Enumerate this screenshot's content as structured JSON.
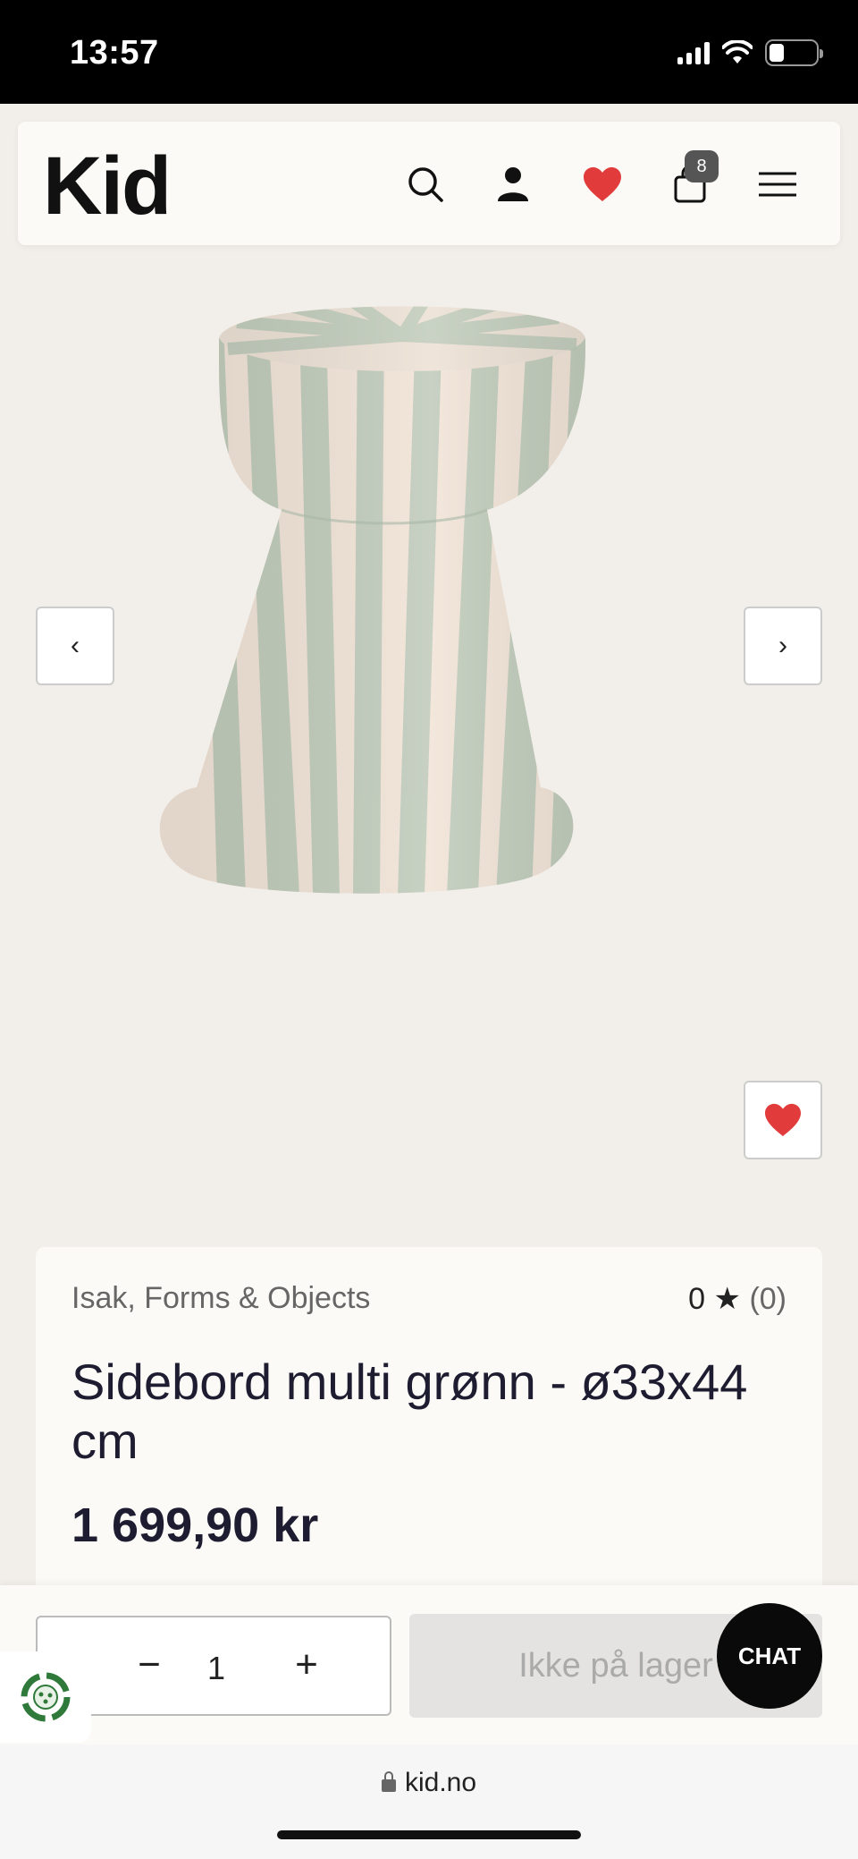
{
  "status_bar": {
    "time": "13:57"
  },
  "header": {
    "logo": "Kid",
    "cart_count": "8",
    "icons": [
      "search-icon",
      "user-icon",
      "heart-icon",
      "bag-icon",
      "menu-icon"
    ]
  },
  "gallery": {
    "prev_label": "‹",
    "next_label": "›",
    "image_alt": "Striped side table"
  },
  "product": {
    "brand": "Isak, Forms & Objects",
    "rating_value": "0 ★",
    "rating_count": "(0)",
    "title": "Sidebord multi grønn - ø33x44 cm",
    "price": "1 699,90 kr"
  },
  "cart": {
    "quantity": "1",
    "minus_label": "−",
    "plus_label": "+",
    "stock_label": "Ikke på lager"
  },
  "chat": {
    "label": "CHAT"
  },
  "browser": {
    "url": "kid.no"
  },
  "colors": {
    "heart": "#e23b3b",
    "stripe_green": "#b9c7b6",
    "ceramic_cream": "#f1e3d6"
  }
}
